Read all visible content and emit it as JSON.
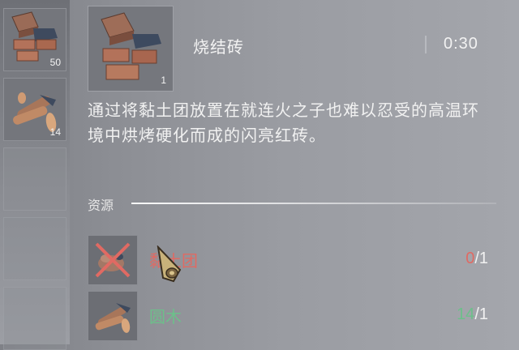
{
  "sidebar": {
    "slots": [
      {
        "name": "brick",
        "count": "50",
        "icon": "brick-stack-icon"
      },
      {
        "name": "log",
        "count": "14",
        "icon": "log-icon"
      }
    ]
  },
  "detail": {
    "count": "1",
    "icon": "brick-stack-icon",
    "title": "烧结砖",
    "timer": "0:30",
    "description": "通过将黏土团放置在就连火之子也难以忍受的高温环境中烘烤硬化而成的闪亮红砖。"
  },
  "resources": {
    "label": "资源",
    "items": [
      {
        "name": "黏土团",
        "have": "0",
        "need": "/1",
        "status": "missing",
        "icon": "clay-icon"
      },
      {
        "name": "圆木",
        "have": "14",
        "need": "/1",
        "status": "ok",
        "icon": "log-icon"
      }
    ]
  },
  "colors": {
    "missing": "#e06a63",
    "ok": "#6cc08a"
  }
}
